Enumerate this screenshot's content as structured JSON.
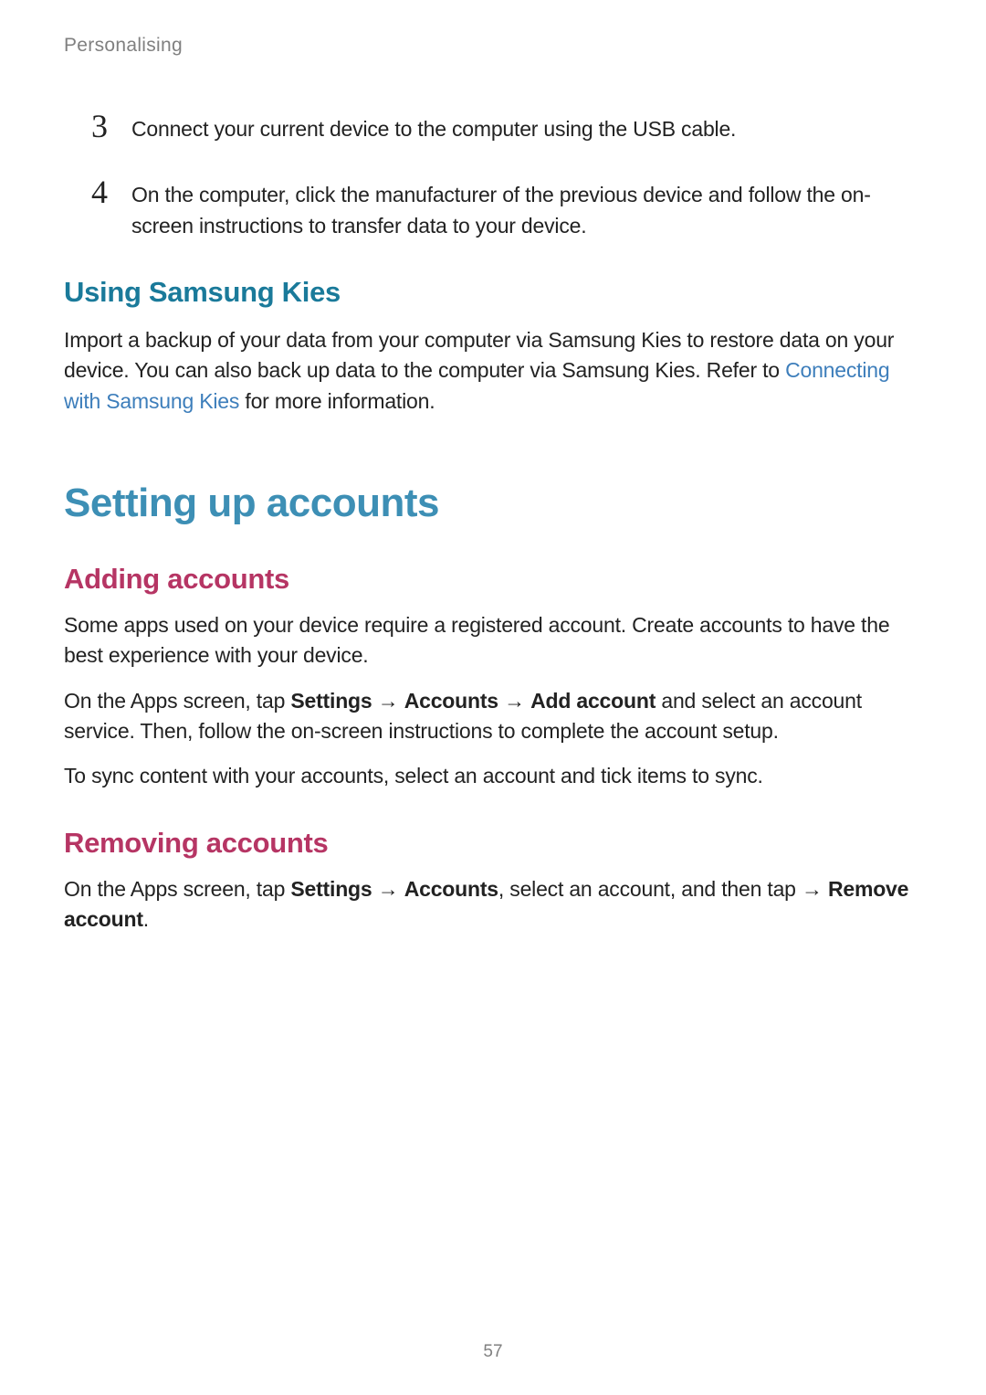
{
  "header": {
    "section_name": "Personalising"
  },
  "steps": {
    "step3": {
      "number": "3",
      "text": "Connect your current device to the computer using the USB cable."
    },
    "step4": {
      "number": "4",
      "text": "On the computer, click the manufacturer of the previous device and follow the on-screen instructions to transfer data to your device."
    }
  },
  "samsung_kies": {
    "heading": "Using Samsung Kies",
    "text_part1": "Import a backup of your data from your computer via Samsung Kies to restore data on your device. You can also back up data to the computer via Samsung Kies. Refer to ",
    "link_text": "Connecting with Samsung Kies",
    "text_part2": " for more information."
  },
  "main_section": {
    "heading": "Setting up accounts"
  },
  "adding_accounts": {
    "heading": "Adding accounts",
    "para1": "Some apps used on your device require a registered account. Create accounts to have the best experience with your device.",
    "para2_part1": "On the Apps screen, tap ",
    "para2_bold1": "Settings",
    "para2_arrow1": " → ",
    "para2_bold2": "Accounts",
    "para2_arrow2": " → ",
    "para2_bold3": "Add account",
    "para2_part2": " and select an account service. Then, follow the on-screen instructions to complete the account setup.",
    "para3": "To sync content with your accounts, select an account and tick items to sync."
  },
  "removing_accounts": {
    "heading": "Removing accounts",
    "para_part1": "On the Apps screen, tap ",
    "para_bold1": "Settings",
    "para_arrow1": " → ",
    "para_bold2": "Accounts",
    "para_part2": ", select an account, and then tap ",
    "para_arrow2": "  → ",
    "para_bold3": "Remove account",
    "para_part3": "."
  },
  "footer": {
    "page_number": "57"
  }
}
